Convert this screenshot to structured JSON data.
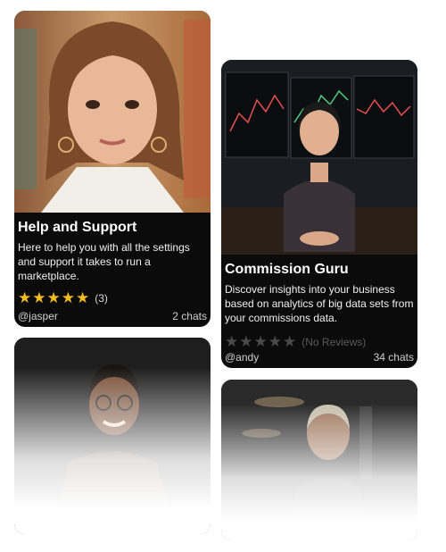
{
  "cards": [
    {
      "title": "Help and Support",
      "description": "Here to help you with all the settings and support it takes to run a marketplace.",
      "rating": 5,
      "rating_text": "(3)",
      "author": "@jasper",
      "chats": "2 chats",
      "icon": "portrait-woman-brown-hair"
    },
    {
      "title": "Commission Guru",
      "description": "Discover insights into your business based on analytics of big data sets from your commissions data.",
      "rating": 0,
      "rating_text": "(No Reviews)",
      "author": "@andy",
      "chats": "34 chats",
      "icon": "portrait-woman-trading-desk"
    },
    {
      "icon": "portrait-man-glasses"
    },
    {
      "icon": "portrait-man-office"
    }
  ],
  "colors": {
    "star_filled": "#f5bd22",
    "star_empty": "#4a4a4a",
    "card_bg": "#0b0b0b"
  }
}
